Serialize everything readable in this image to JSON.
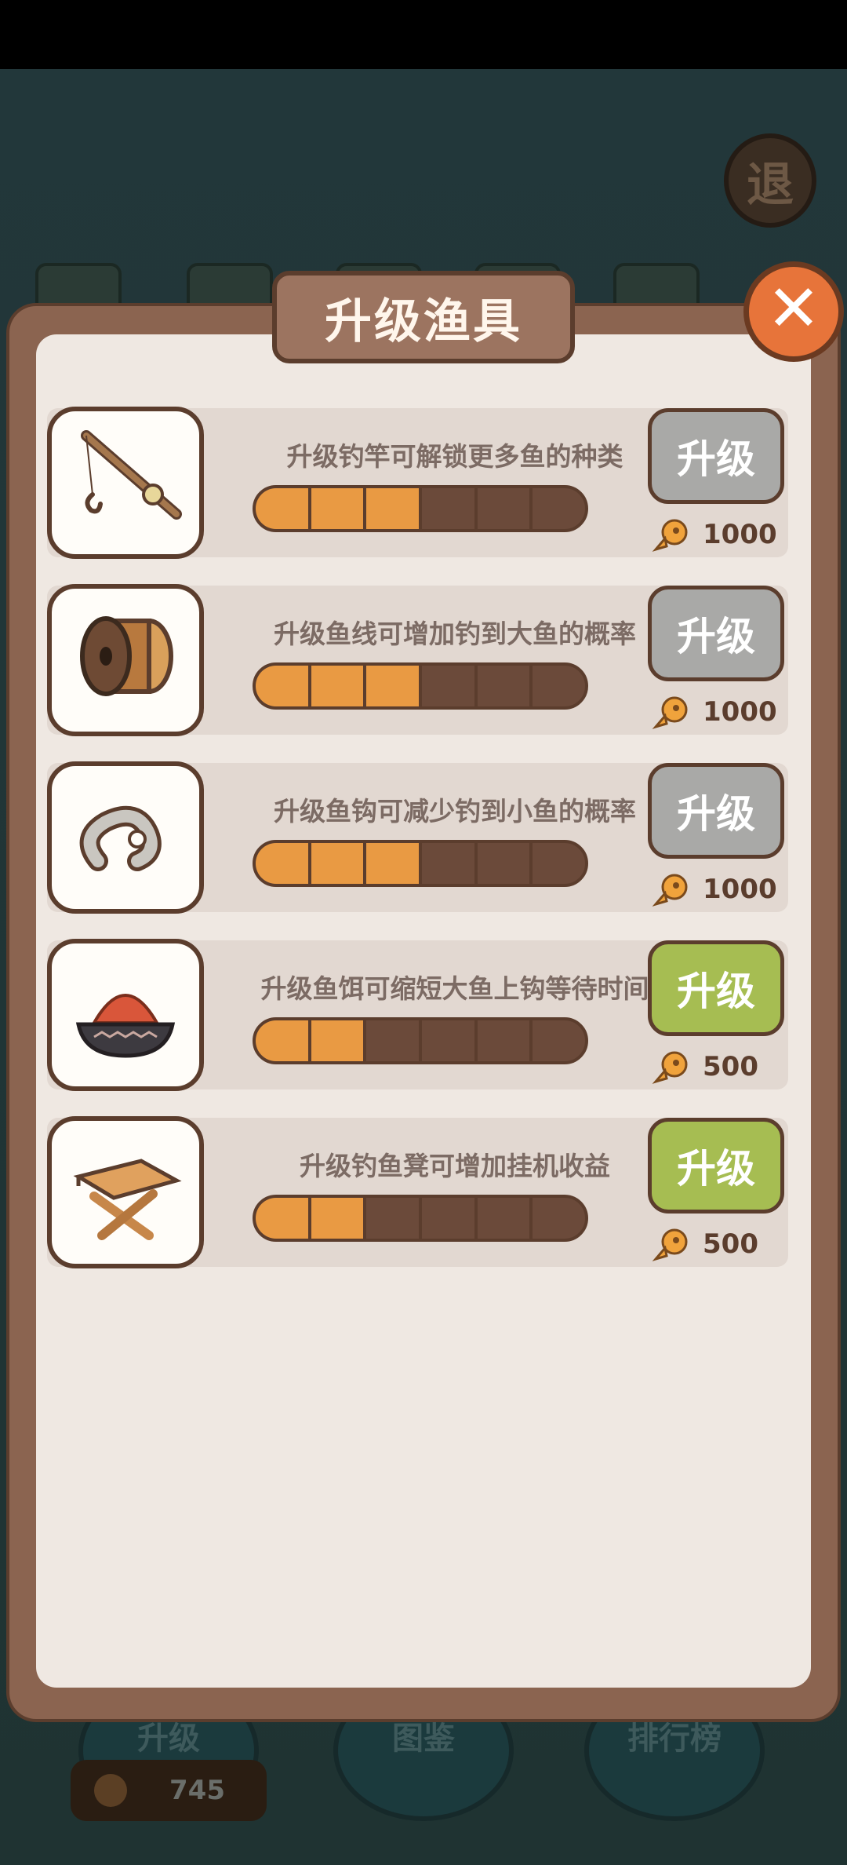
{
  "background": {
    "exit_label": "退",
    "bottom_nav": [
      {
        "label": "升级"
      },
      {
        "label": "图鉴"
      },
      {
        "label": "排行榜"
      }
    ],
    "coin_amount": "745"
  },
  "dialog": {
    "title": "升级渔具",
    "close_icon": "close-x"
  },
  "rows": [
    {
      "item": "fishing-rod",
      "desc": "升级钓竿可解锁更多鱼的种类",
      "level": 3,
      "max_level": 6,
      "button": "升级",
      "enabled": false,
      "cost": "1000"
    },
    {
      "item": "fishing-line-spool",
      "desc": "升级鱼线可增加钓到大鱼的概率",
      "level": 3,
      "max_level": 6,
      "button": "升级",
      "enabled": false,
      "cost": "1000"
    },
    {
      "item": "fish-hook",
      "desc": "升级鱼钩可减少钓到小鱼的概率",
      "level": 3,
      "max_level": 6,
      "button": "升级",
      "enabled": false,
      "cost": "1000"
    },
    {
      "item": "fish-bait-bowl",
      "desc": "升级鱼饵可缩短大鱼上钩等待时间",
      "level": 2,
      "max_level": 6,
      "button": "升级",
      "enabled": true,
      "cost": "500"
    },
    {
      "item": "fishing-stool",
      "desc": "升级钓鱼凳可增加挂机收益",
      "level": 2,
      "max_level": 6,
      "button": "升级",
      "enabled": true,
      "cost": "500"
    }
  ],
  "colors": {
    "button_disabled": "#a9a9a7",
    "button_enabled": "#a6bd52",
    "progress_fill": "#e99a43",
    "progress_empty": "#6b4a3a"
  }
}
